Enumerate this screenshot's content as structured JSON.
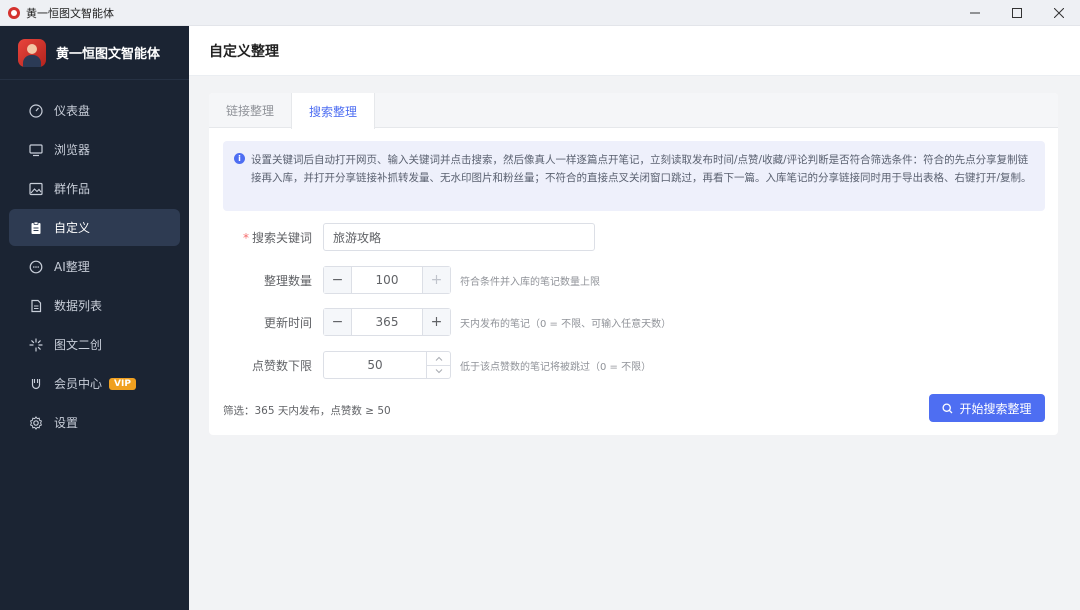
{
  "window": {
    "title": "黄一恒图文智能体"
  },
  "sidebar": {
    "brand_name": "黄一恒图文智能体",
    "items": [
      {
        "label": "仪表盘",
        "icon": "dashboard-icon"
      },
      {
        "label": "浏览器",
        "icon": "monitor-icon"
      },
      {
        "label": "群作品",
        "icon": "image-icon"
      },
      {
        "label": "自定义",
        "icon": "clipboard-icon",
        "active": true
      },
      {
        "label": "AI整理",
        "icon": "chat-icon"
      },
      {
        "label": "数据列表",
        "icon": "document-icon"
      },
      {
        "label": "图文二创",
        "icon": "sparkle-icon"
      },
      {
        "label": "会员中心",
        "icon": "member-icon",
        "badge": "VIP"
      },
      {
        "label": "设置",
        "icon": "gear-icon"
      }
    ]
  },
  "header": {
    "title": "自定义整理"
  },
  "tabs": [
    {
      "label": "链接整理",
      "active": false
    },
    {
      "label": "搜索整理",
      "active": true
    }
  ],
  "notice": {
    "text": "设置关键词后自动打开网页、输入关键词并点击搜索，然后像真人一样逐篇点开笔记，立刻读取发布时间/点赞/收藏/评论判断是否符合筛选条件：符合的先点分享复制链接再入库，并打开分享链接补抓转发量、无水印图片和粉丝量；不符合的直接点叉关闭窗口跳过，再看下一篇。入库笔记的分享链接同时用于导出表格、右键打开/复制。"
  },
  "form": {
    "keyword": {
      "label": "搜索关键词",
      "value": "旅游攻略"
    },
    "count": {
      "label": "整理数量",
      "value": "100",
      "hint": "符合条件并入库的笔记数量上限"
    },
    "days": {
      "label": "更新时间",
      "value": "365",
      "hint": "天内发布的笔记（0 = 不限、可输入任意天数）"
    },
    "likes": {
      "label": "点赞数下限",
      "value": "50",
      "hint": "低于该点赞数的笔记将被跳过（0 = 不限）"
    }
  },
  "filter_summary": "筛选：365 天内发布，点赞数 ≥ 50",
  "start_button": "开始搜索整理",
  "colors": {
    "sidebar_bg": "#1b2433",
    "accent": "#4e6ef2",
    "vip_badge": "#f0a020"
  }
}
